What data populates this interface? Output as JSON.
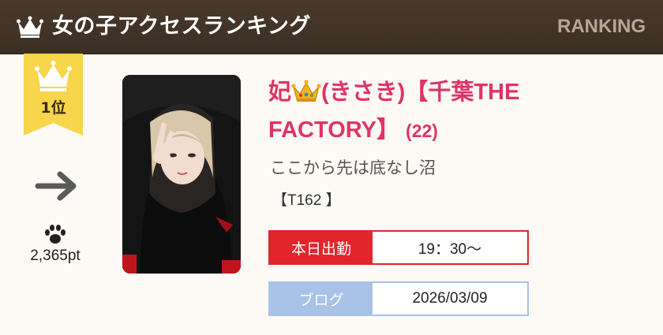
{
  "header": {
    "title": "女の子アクセスランキング",
    "subtitle": "RANKING",
    "crown_icon": "crown-icon"
  },
  "rank": {
    "position_label": "1位",
    "trend_icon": "arrow-right-icon",
    "trend": "unchanged",
    "paw_icon": "paw-icon",
    "points": "2,365pt"
  },
  "profile": {
    "photo_icon": "girl-photo",
    "name_prefix": "妃",
    "name_emoji": "crown-emoji",
    "name_main": "(きさき)【千葉THE FACTORY】",
    "age": "(22)",
    "catchphrase": "ここから先は底なし沼",
    "spec": "【T162 】"
  },
  "schedule": {
    "label": "本日出勤",
    "value": "19：30～"
  },
  "blog": {
    "label": "ブログ",
    "value": "2026/03/09"
  },
  "colors": {
    "header_bg": "#3b2e23",
    "header_sub": "#b8a891",
    "badge_gold": "#f7d64c",
    "name_pink": "#e0336a",
    "work_red": "#e2252b",
    "blog_blue": "#a9c2e8",
    "background": "#fdfaf5"
  }
}
